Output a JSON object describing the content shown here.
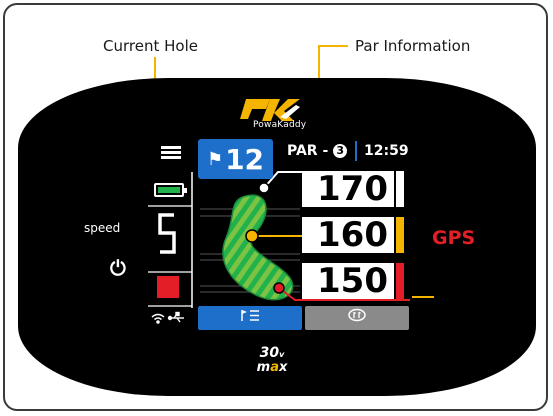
{
  "callouts": {
    "current_hole": "Current Hole",
    "par_information": "Par Information"
  },
  "brand": {
    "name": "PowaKaddy",
    "accent_color": "#f4b400",
    "model_top": "30",
    "model_suffix": "v",
    "model_bottom_prefix": "m",
    "model_bottom_accent": "a",
    "model_bottom_suffix": "x"
  },
  "header": {
    "hole_number": "12",
    "par_label": "PAR -",
    "par_value": "3",
    "time": "12:59"
  },
  "sidebar": {
    "speed_label": "speed",
    "speed_value": "5",
    "battery_icon": "battery-icon",
    "power_icon": "power-icon",
    "stop_icon": "stop-icon",
    "connectivity_icons": [
      "wifi-icon",
      "usb-icon"
    ]
  },
  "distances": [
    {
      "value": "170",
      "bar_color": "#ffffff"
    },
    {
      "value": "160",
      "bar_color": "#f4b400"
    },
    {
      "value": "150",
      "bar_color": "#e41e26"
    }
  ],
  "tabs": {
    "left_icon": "flag-list-icon",
    "right_icon": "green-view-icon"
  },
  "mode_label": "GPS",
  "colors": {
    "blue": "#1e6fc9",
    "green": "#22b24c",
    "red": "#e41e26",
    "yellow": "#f4b400"
  }
}
